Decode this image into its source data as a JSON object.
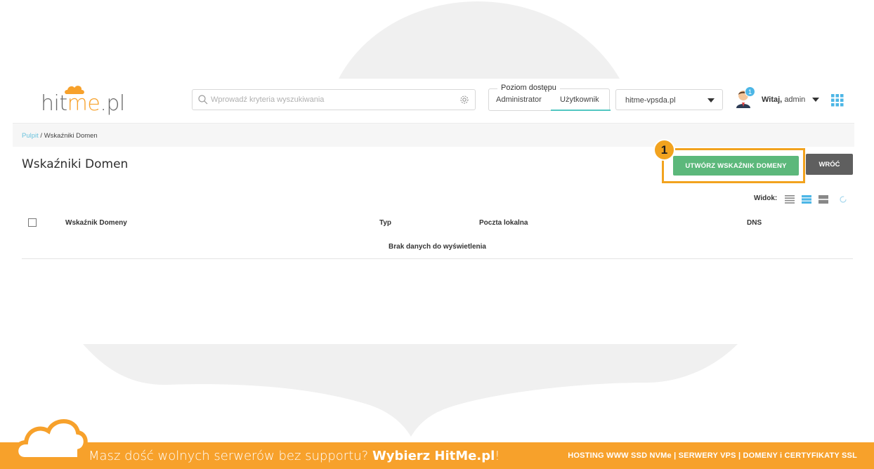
{
  "header": {
    "logo": {
      "text_a": "hit",
      "text_b": "me",
      "text_c": ".pl"
    },
    "search": {
      "placeholder": "Wprowadź kryteria wyszukiwania"
    },
    "access_level": {
      "legend": "Poziom dostępu",
      "options": [
        "Administrator",
        "Użytkownik"
      ],
      "selected": "Użytkownik"
    },
    "server_select": {
      "value": "hitme-vpsda.pl"
    },
    "notifications": {
      "count": "1"
    },
    "user": {
      "greeting": "Witaj,",
      "name": "admin"
    }
  },
  "breadcrumb": {
    "root": "Pulpit",
    "separator": " / ",
    "current": "Wskaźniki Domen"
  },
  "main": {
    "title": "Wskaźniki Domen",
    "create_button": "UTWÓRZ WSKAŹNIK DOMENY",
    "back_button": "WRÓĆ",
    "marker": "1",
    "view_label": "Widok:",
    "table": {
      "columns": [
        "Wskaźnik Domeny",
        "Typ",
        "Poczta lokalna",
        "DNS"
      ],
      "empty": "Brak danych do wyświetlenia"
    }
  },
  "banner": {
    "left_text": "Masz dość wolnych serwerów bez supportu?",
    "left_bold": "Wybierz HitMe.pl",
    "left_end": "!",
    "right_text": "HOSTING WWW SSD NVMe | SERWERY VPS | DOMENY i CERTYFIKATY SSL"
  },
  "colors": {
    "accent_orange": "#f7a12b",
    "create_green": "#5cb87b",
    "back_gray": "#5f5f5f",
    "link_blue": "#6cc3dd",
    "teal_underline": "#53c7c2"
  }
}
